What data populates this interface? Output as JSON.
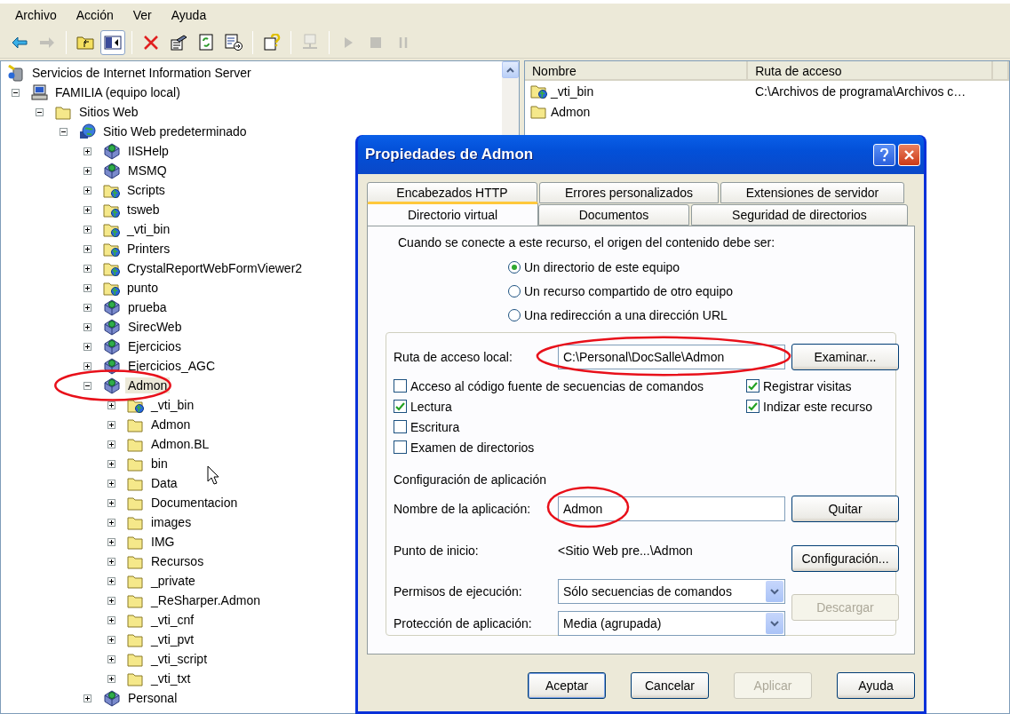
{
  "menu": [
    "Archivo",
    "Acción",
    "Ver",
    "Ayuda"
  ],
  "toolbar": [
    {
      "kind": "back",
      "disabled": false,
      "pressed": false
    },
    {
      "kind": "forward",
      "disabled": true,
      "pressed": false
    },
    {
      "kind": "separator"
    },
    {
      "kind": "up",
      "disabled": false,
      "pressed": false
    },
    {
      "kind": "tree",
      "disabled": false,
      "pressed": true
    },
    {
      "kind": "separator"
    },
    {
      "kind": "delete",
      "disabled": false,
      "pressed": false
    },
    {
      "kind": "properties",
      "disabled": false,
      "pressed": false
    },
    {
      "kind": "refresh",
      "disabled": false,
      "pressed": false
    },
    {
      "kind": "export",
      "disabled": false,
      "pressed": false
    },
    {
      "kind": "separator"
    },
    {
      "kind": "help",
      "disabled": false,
      "pressed": false
    },
    {
      "kind": "separator"
    },
    {
      "kind": "connect",
      "disabled": true,
      "pressed": false
    },
    {
      "kind": "separator"
    },
    {
      "kind": "play",
      "disabled": true,
      "pressed": false
    },
    {
      "kind": "stop",
      "disabled": true,
      "pressed": false
    },
    {
      "kind": "pause",
      "disabled": true,
      "pressed": false
    }
  ],
  "tree": [
    {
      "kind": "root",
      "label": "Servicios de Internet Information Server",
      "selected": false,
      "children": [
        {
          "kind": "computer",
          "label": "FAMILIA (equipo local)",
          "expanded": true,
          "selected": false,
          "children": [
            {
              "kind": "folder",
              "label": "Sitios Web",
              "expanded": true,
              "selected": false,
              "children": [
                {
                  "kind": "site",
                  "label": "Sitio Web predeterminado",
                  "expanded": true,
                  "selected": false,
                  "children": [
                    {
                      "kind": "app",
                      "label": "IISHelp",
                      "expanded": false,
                      "selected": false
                    },
                    {
                      "kind": "app",
                      "label": "MSMQ",
                      "expanded": false,
                      "selected": false
                    },
                    {
                      "kind": "vdir",
                      "label": "Scripts",
                      "expanded": false,
                      "selected": false
                    },
                    {
                      "kind": "vdir",
                      "label": "tsweb",
                      "expanded": false,
                      "selected": false
                    },
                    {
                      "kind": "vdir",
                      "label": "_vti_bin",
                      "expanded": false,
                      "selected": false
                    },
                    {
                      "kind": "vdir",
                      "label": "Printers",
                      "expanded": false,
                      "selected": false
                    },
                    {
                      "kind": "vdir",
                      "label": "CrystalReportWebFormViewer2",
                      "expanded": false,
                      "selected": false
                    },
                    {
                      "kind": "vdir",
                      "label": "punto",
                      "expanded": false,
                      "selected": false
                    },
                    {
                      "kind": "app",
                      "label": "prueba",
                      "expanded": false,
                      "selected": false
                    },
                    {
                      "kind": "app",
                      "label": "SirecWeb",
                      "expanded": false,
                      "selected": false
                    },
                    {
                      "kind": "app",
                      "label": "Ejercicios",
                      "expanded": false,
                      "selected": false
                    },
                    {
                      "kind": "app",
                      "label": "Ejercicios_AGC",
                      "expanded": false,
                      "selected": false
                    },
                    {
                      "kind": "app",
                      "label": "Admon",
                      "expanded": true,
                      "selected": true,
                      "circled": true,
                      "children": [
                        {
                          "kind": "vdir",
                          "label": "_vti_bin",
                          "expanded": false,
                          "selected": false
                        },
                        {
                          "kind": "folder",
                          "label": "Admon",
                          "expanded": false,
                          "selected": false
                        },
                        {
                          "kind": "folder",
                          "label": "Admon.BL",
                          "expanded": false,
                          "selected": false
                        },
                        {
                          "kind": "folder",
                          "label": "bin",
                          "expanded": false,
                          "selected": false
                        },
                        {
                          "kind": "folder",
                          "label": "Data",
                          "expanded": false,
                          "selected": false
                        },
                        {
                          "kind": "folder",
                          "label": "Documentacion",
                          "expanded": false,
                          "selected": false
                        },
                        {
                          "kind": "folder",
                          "label": "images",
                          "expanded": false,
                          "selected": false
                        },
                        {
                          "kind": "folder",
                          "label": "IMG",
                          "expanded": false,
                          "selected": false
                        },
                        {
                          "kind": "folder",
                          "label": "Recursos",
                          "expanded": false,
                          "selected": false
                        },
                        {
                          "kind": "folder",
                          "label": "_private",
                          "expanded": false,
                          "selected": false
                        },
                        {
                          "kind": "folder",
                          "label": "_ReSharper.Admon",
                          "expanded": false,
                          "selected": false
                        },
                        {
                          "kind": "folder",
                          "label": "_vti_cnf",
                          "expanded": false,
                          "selected": false
                        },
                        {
                          "kind": "folder",
                          "label": "_vti_pvt",
                          "expanded": false,
                          "selected": false
                        },
                        {
                          "kind": "folder",
                          "label": "_vti_script",
                          "expanded": false,
                          "selected": false
                        },
                        {
                          "kind": "folder",
                          "label": "_vti_txt",
                          "expanded": false,
                          "selected": false
                        }
                      ]
                    },
                    {
                      "kind": "app",
                      "label": "Personal",
                      "expanded": false,
                      "selected": false
                    }
                  ]
                }
              ]
            }
          ]
        }
      ]
    }
  ],
  "list": {
    "columns": [
      "Nombre",
      "Ruta de acceso"
    ],
    "rows": [
      {
        "kind": "vdir",
        "name": "_vti_bin",
        "path": "C:\\Archivos de programa\\Archivos c…"
      },
      {
        "kind": "folder",
        "name": "Admon"
      }
    ]
  },
  "dialog": {
    "title": "Propiedades de Admon",
    "tab_rows": [
      [
        {
          "label": "Encabezados HTTP",
          "selected": false
        },
        {
          "label": "Errores personalizados",
          "selected": false
        },
        {
          "label": "Extensiones de servidor",
          "selected": false
        }
      ],
      [
        {
          "label": "Directorio virtual",
          "selected": true
        },
        {
          "label": "Documentos",
          "selected": false
        },
        {
          "label": "Seguridad de directorios",
          "selected": false
        }
      ]
    ],
    "intro": "Cuando se conecte a este recurso, el origen del contenido debe ser:",
    "source_options": [
      {
        "label": "Un directorio de este equipo",
        "selected": true
      },
      {
        "label": "Un recurso compartido de otro equipo",
        "selected": false
      },
      {
        "label": "Una redirección a una dirección URL",
        "selected": false
      }
    ],
    "local_path": {
      "label": "Ruta de acceso local:",
      "value": "C:\\Personal\\DocSalle\\Admon",
      "circled": true,
      "button": {
        "label": "Examinar...",
        "disabled": false
      }
    },
    "permissions_left": [
      {
        "label": "Acceso al código fuente de secuencias de comandos",
        "checked": false
      },
      {
        "label": "Lectura",
        "checked": true
      },
      {
        "label": "Escritura",
        "checked": false
      },
      {
        "label": "Examen de directorios",
        "checked": false
      }
    ],
    "permissions_right": [
      {
        "label": "Registrar visitas",
        "checked": true
      },
      {
        "label": "Indizar este recurso",
        "checked": true
      }
    ],
    "app_section": {
      "title": "Configuración de aplicación",
      "name": {
        "label": "Nombre de la aplicación:",
        "value": "Admon",
        "circled": true,
        "button": {
          "label": "Quitar",
          "disabled": false
        }
      },
      "start_point": {
        "label": "Punto de inicio:",
        "value": "<Sitio Web pre...\\Admon",
        "button": {
          "label": "Configuración...",
          "disabled": false
        }
      },
      "execute": {
        "label": "Permisos de ejecución:",
        "value": "Sólo secuencias de comandos"
      },
      "protection": {
        "label": "Protección de aplicación:",
        "value": "Media (agrupada)",
        "button": {
          "label": "Descargar",
          "disabled": true
        }
      }
    },
    "buttons": [
      {
        "label": "Aceptar",
        "disabled": false
      },
      {
        "label": "Cancelar",
        "disabled": false
      },
      {
        "label": "Aplicar",
        "disabled": true
      },
      {
        "label": "Ayuda",
        "disabled": false
      }
    ]
  }
}
